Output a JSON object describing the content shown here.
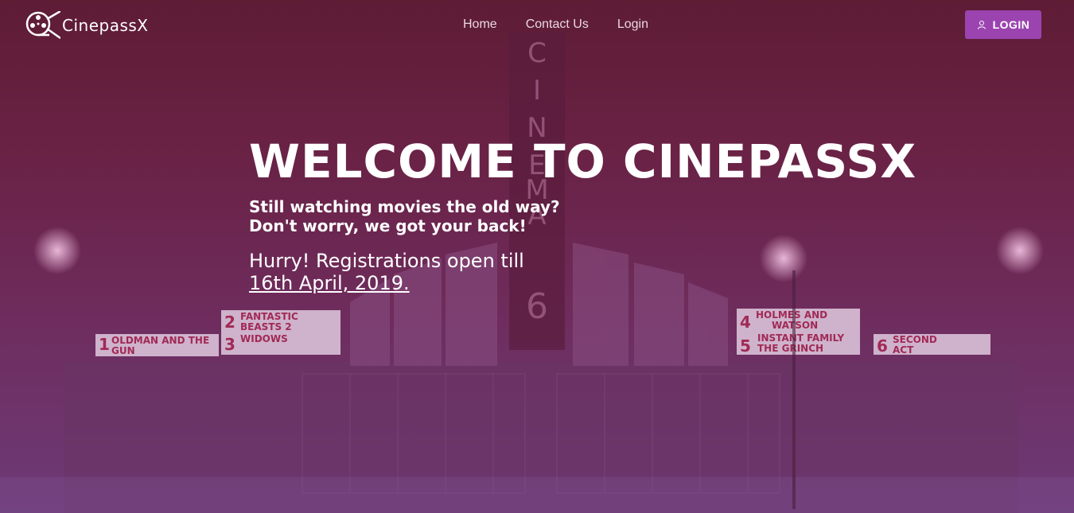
{
  "brand": {
    "name": "CinepassX"
  },
  "nav": {
    "items": [
      "Home",
      "Contact Us",
      "Login"
    ]
  },
  "login_button": {
    "label": "LOGIN"
  },
  "hero": {
    "title": "WELCOME TO CINEPASSX",
    "subtitle_line1": "Still watching movies the old way?",
    "subtitle_line2": "Don't worry, we got your back!",
    "hurry": "Hurry! Registrations open till",
    "date": "16th April, 2019."
  },
  "marquee": {
    "sign": [
      "C",
      "I",
      "N",
      "E",
      "M",
      "A"
    ],
    "screen_number": "6",
    "boards": [
      {
        "num": "1",
        "lines": [
          "OLDMAN AND THE",
          "GUN"
        ]
      },
      {
        "num": "2",
        "lines": [
          "FANTASTIC",
          "BEASTS 2"
        ]
      },
      {
        "num": "3",
        "lines": [
          "WIDOWS"
        ]
      },
      {
        "num": "4",
        "lines": [
          "HOLMES AND",
          "WATSON"
        ]
      },
      {
        "num": "5",
        "lines": [
          "INSTANT FAMILY",
          "THE GRINCH"
        ]
      },
      {
        "num": "6",
        "lines": [
          "SECOND",
          "ACT"
        ]
      }
    ]
  },
  "colors": {
    "accent": "#9b44b0",
    "bg_top": "#5e1c35",
    "bg_bottom": "#6d3a78"
  }
}
